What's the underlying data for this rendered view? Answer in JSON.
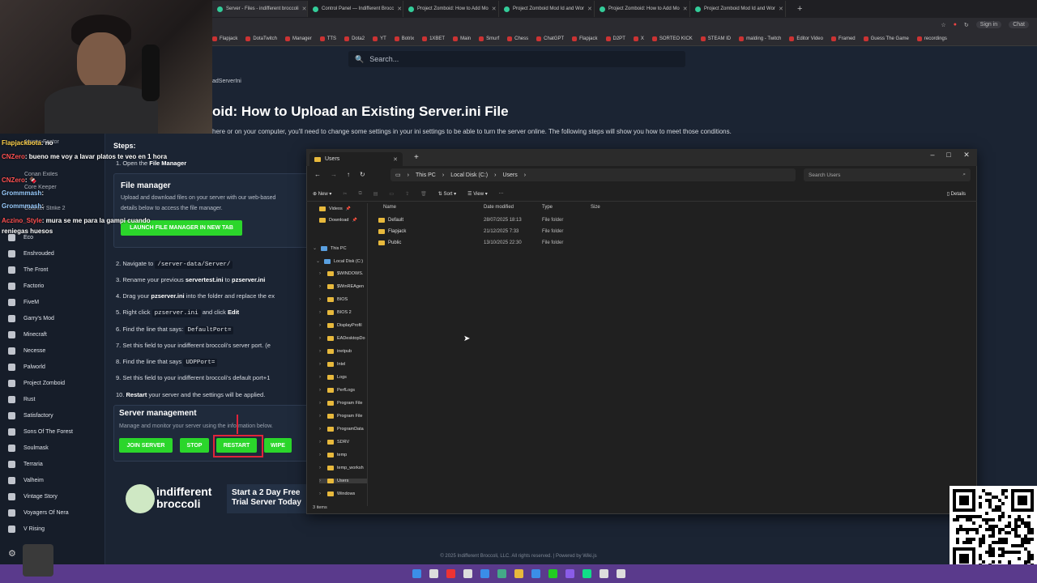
{
  "browser": {
    "tabs": [
      "Server - Files - indifferent broccoli",
      "Control Panel — Indifferent Brocc",
      "Project Zomboid: How to Add Mo",
      "Project Zomboid Mod Id and Wor",
      "Project Zomboid: How to Add Mo",
      "Project Zomboid Mod Id and Wor"
    ],
    "bookmarks": [
      "Flapjack",
      "DotaTwitch",
      "Manager",
      "TTS",
      "Dota2",
      "YT",
      "Botrix",
      "1XBET",
      "Main",
      "Smurf",
      "Chess",
      "ChatGPT",
      "Flapjack",
      "D2PT",
      "X",
      "SORTEO KICK",
      "STEAM ID",
      "malding - Twitch",
      "Editor Video",
      "Framed",
      "Guess The Game",
      "recordings"
    ],
    "sign_in": "Sign in",
    "profile": "Chat"
  },
  "page": {
    "search_placeholder": "Search...",
    "breadcrumb": "adServerIni",
    "title": "oid: How to Upload an Existing Server.ini File",
    "intro": "here or on your computer, you'll need to change some settings in your ini settings to be able to turn the server online. The following steps will show you how to meet those conditions.",
    "steps_heading": "Steps:",
    "step1": "1. Open the ",
    "step1_bold": "File Manager",
    "file_manager": {
      "title": "File manager",
      "desc1": "Upload and download files on your server with our web-based",
      "desc2": "details below to access the file manager.",
      "button": "LAUNCH FILE MANAGER IN NEW TAB"
    },
    "step2": "2. Navigate to ",
    "step2_code": "/server-data/Server/",
    "step3": "3. Rename your previous ",
    "step3_b1": "servertest.ini",
    "step3_mid": " to ",
    "step3_b2": "pzserver.ini",
    "step4": "4. Drag your ",
    "step4_b": "pzserver.ini",
    "step4_end": " into the folder  and replace the ex",
    "step5": "5. Right click ",
    "step5_code": "pzserver.ini",
    "step5_end": " and click ",
    "step5_b": "Edit",
    "step6": "6. Find the line that says: ",
    "step6_code": "DefaultPort=",
    "step7": "7. Set this field to your indifferent broccoli's server port. (e",
    "step8": "8. Find the line that says ",
    "step8_code": "UDPPort=",
    "step9": "9. Set this field to your indifferent broccoli's default port+1",
    "step10": "10. ",
    "step10_b": "Restart",
    "step10_end": " your server and the settings will be applied.",
    "server_mgmt": {
      "title": "Server management",
      "desc": "Manage and monitor your server using the information below.",
      "join": "JOIN SERVER",
      "stop": "STOP",
      "restart": "RESTART",
      "wipe": "WIPE"
    },
    "brand1": "indifferent",
    "brand2": "broccoli",
    "trial": "Start a 2 Day Free Trial Server Today",
    "footer": "© 2025 Indifferent Broccoli, LLC. All rights reserved. | Powered by Wiki.js"
  },
  "sidebar": {
    "items": [
      "Eco",
      "Enshrouded",
      "The Front",
      "Factorio",
      "FiveM",
      "Garry's Mod",
      "Minecraft",
      "Necesse",
      "Palworld",
      "Project Zomboid",
      "Rust",
      "Satisfactory",
      "Sons Of The Forest",
      "Soulmask",
      "Terraria",
      "Valheim",
      "Vintage Story",
      "Voyagers Of Nera",
      "V Rising"
    ],
    "hidden_items": [
      "Abiotic Factor",
      "Conan Exiles",
      "Core Keeper",
      "Counter Strike 2"
    ]
  },
  "chat": [
    {
      "user": "Flapjackbota",
      "msg": ": no"
    },
    {
      "user": "CNZero",
      "msg": ": bueno me voy a lavar platos te veo en 1 hora"
    },
    {
      "user": "CNZero",
      "msg": ": 🍫"
    },
    {
      "user": "Grommmash",
      "msg": ":"
    },
    {
      "user": "Grommmash",
      "msg": ":"
    },
    {
      "user": "Aczino_Style",
      "msg": ": mura se me para la gampi cuando reniegas huesos"
    }
  ],
  "explorer": {
    "tab_title": "Users",
    "path": [
      "This PC",
      "Local Disk (C:)",
      "Users"
    ],
    "search_placeholder": "Search Users",
    "cmd": {
      "new": "New",
      "sort": "Sort",
      "view": "View",
      "details": "Details"
    },
    "columns": [
      "Name",
      "Date modified",
      "Type",
      "Size"
    ],
    "files": [
      {
        "name": "Default",
        "date": "28/07/2025 18:13",
        "type": "File folder"
      },
      {
        "name": "Flapjack",
        "date": "21/12/2025 7:33",
        "type": "File folder"
      },
      {
        "name": "Public",
        "date": "13/10/2025 22:30",
        "type": "File folder"
      }
    ],
    "quick": [
      "Videos",
      "Download"
    ],
    "tree": [
      "This PC",
      "Local Disk (C:)",
      "$WINDOWS.",
      "$WinREAgen",
      "BIOS",
      "BIOS 2",
      "DisplayProfil",
      "EADesktopDo",
      "inetpub",
      "Intel",
      "Logs",
      "PerfLogs",
      "Program File",
      "Program File",
      "ProgramData",
      "SDRV",
      "temp",
      "temp_worksh",
      "Users",
      "Windows"
    ],
    "status": "3 items"
  },
  "colors": {
    "accent_green": "#2bd62b",
    "restart_highlight": "#e0243a",
    "taskbar": "#5a3a8c"
  }
}
